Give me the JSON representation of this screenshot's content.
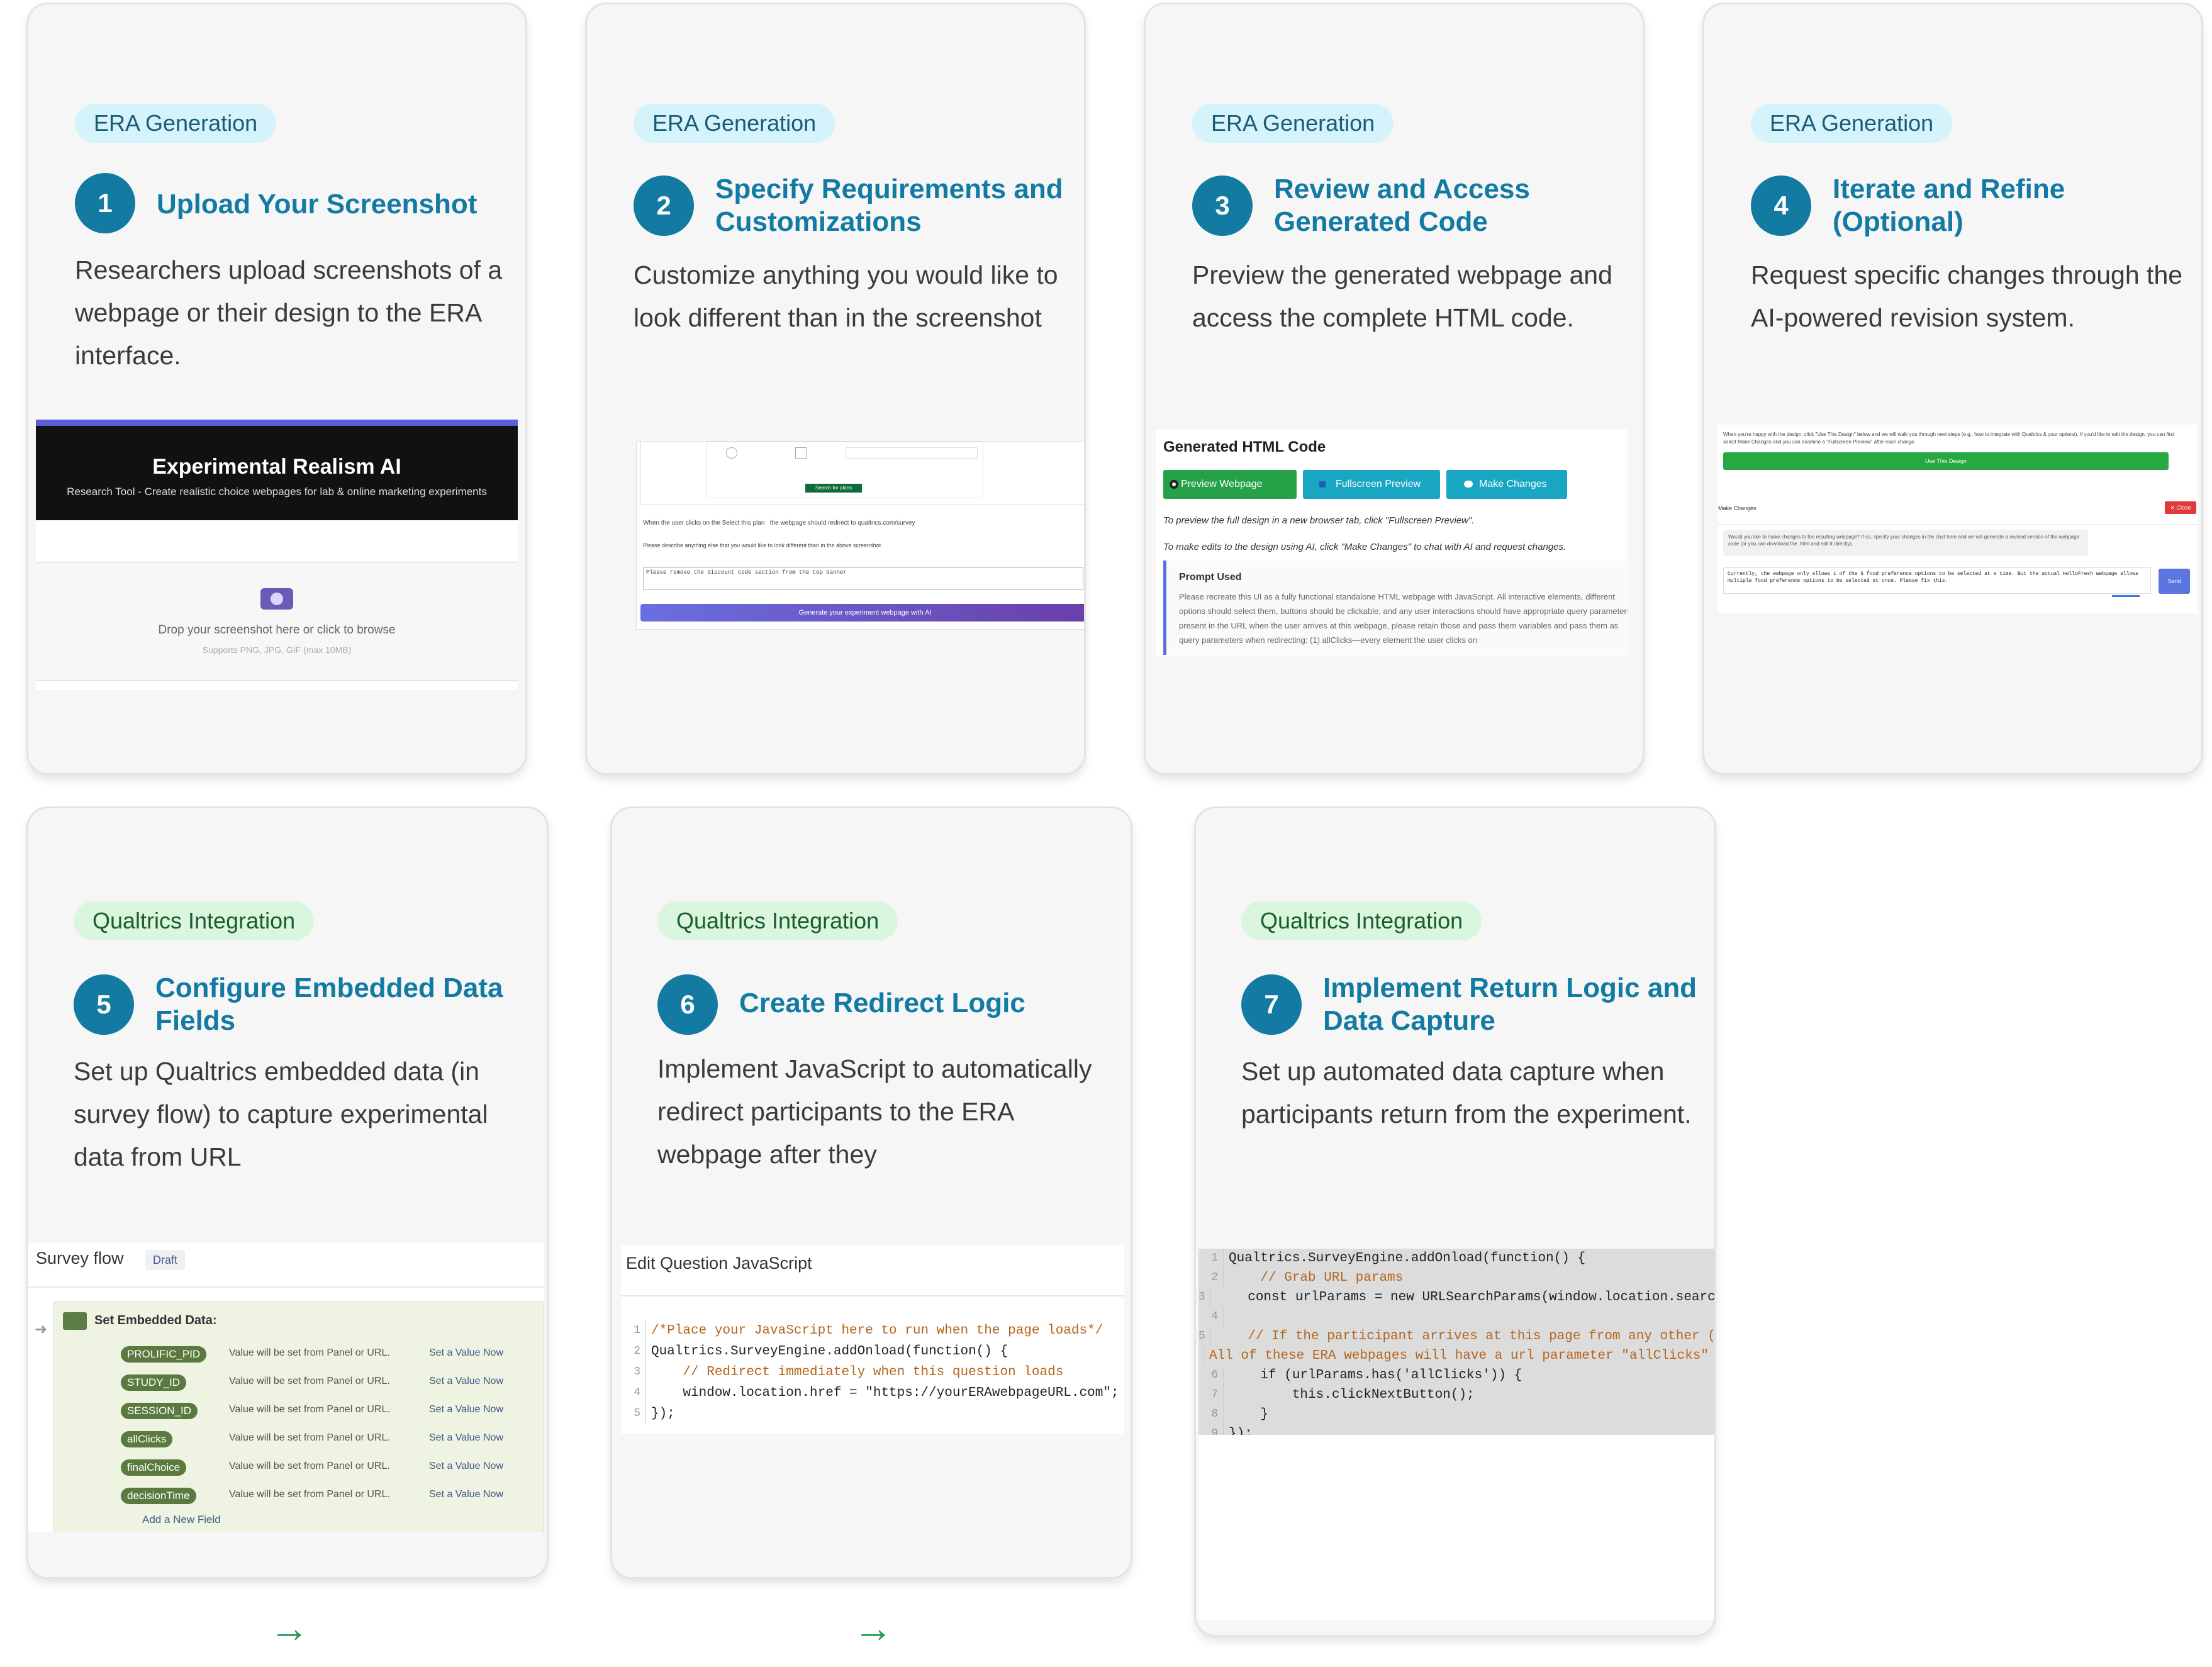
{
  "cards": [
    {
      "tag": "ERA Generation",
      "num": "1",
      "title": "Upload Your Screenshot",
      "desc": "Researchers upload screenshots of a webpage or their design to the ERA interface."
    },
    {
      "tag": "ERA Generation",
      "num": "2",
      "title": "Specify Requirements and Customizations",
      "desc": "Customize anything you would like to look different than in the screenshot"
    },
    {
      "tag": "ERA Generation",
      "num": "3",
      "title": "Review and Access Generated Code",
      "desc": "Preview the generated webpage and access the complete HTML code."
    },
    {
      "tag": "ERA Generation",
      "num": "4",
      "title": "Iterate and Refine (Optional)",
      "desc": "Request specific changes through the AI-powered revision system."
    },
    {
      "tag": "Qualtrics Integration",
      "num": "5",
      "title": "Configure Embedded Data Fields",
      "desc": "Set up Qualtrics embedded data (in survey flow) to capture experimental data from URL"
    },
    {
      "tag": "Qualtrics Integration",
      "num": "6",
      "title": "Create Redirect Logic",
      "desc": "Implement JavaScript to automatically redirect participants to the ERA webpage after they"
    },
    {
      "tag": "Qualtrics Integration",
      "num": "7",
      "title": "Implement Return Logic and Data Capture",
      "desc": "Set up automated data capture when participants return from the experiment."
    }
  ],
  "shot1": {
    "title": "Experimental Realism AI",
    "subtitle": "Research Tool - Create realistic choice webpages for lab & online marketing experiments",
    "drop": "Drop your screenshot here or click to browse",
    "supports": "Supports PNG, JPG, GIF (max 10MB)",
    "icon": "camera-icon"
  },
  "shot2": {
    "line1": "When the user clicks on the Select this plan",
    "line2": "the webpage should redirect to qualtrics.com/survey",
    "prompt": "Please describe anything else that you would like to look different than in the above screenshot",
    "textarea": "Please remove the discount code section from the top banner",
    "button": "Generate your experiment webpage with AI",
    "mini_button": "Search for plans"
  },
  "shot3": {
    "heading": "Generated HTML Code",
    "btn_preview": "Preview Webpage",
    "btn_fullscreen": "Fullscreen Preview",
    "btn_changes": "Make Changes",
    "note1": "To preview the full design in a new browser tab, click \"Fullscreen Preview\".",
    "note2": "To make edits to the design using AI, click \"Make Changes\" to chat with AI and request changes.",
    "prompt_heading": "Prompt Used",
    "prompt_text": "Please recreate this UI as a fully functional standalone HTML webpage with JavaScript. All interactive elements, different options should select them, buttons should be clickable, and any user interactions should have appropriate query parameters present in the URL when the user arrives at this webpage, please retain those and pass them variables and pass them as query parameters when redirecting: (1) allClicks—every element the user clicks on"
  },
  "shot4": {
    "intro": "When you're happy with the design, click \"Use This Design\" below and we will walk you through next steps (e.g., how to integrate with Qualtrics & your options). If you'd like to edit the design, you can first select Make Changes and you can examine a \"Fullscreen Preview\" after each change.",
    "use_button": "Use This Design",
    "make_changes": "Make Changes",
    "close": "✕ Close",
    "bot_msg": "Would you like to make changes to the resulting webpage? If so, specify your changes in the chat here and we will generate a revised version of the webpage code (or you can download the .html and edit it directly).",
    "user_msg": "Currently, the webpage only allows 1 of the 6 food preference options to be selected at a time. But the actual HelloFresh webpage allows multiple food preference options to be selected at once. Please fix this.",
    "send": "Send"
  },
  "shot5": {
    "title": "Survey flow",
    "badge": "Draft",
    "block": "Set Embedded Data:",
    "fields": [
      {
        "name": "PROLIFIC_PID",
        "note": "Value will be set from Panel or URL.",
        "action": "Set a Value Now"
      },
      {
        "name": "STUDY_ID",
        "note": "Value will be set from Panel or URL.",
        "action": "Set a Value Now"
      },
      {
        "name": "SESSION_ID",
        "note": "Value will be set from Panel or URL.",
        "action": "Set a Value Now"
      },
      {
        "name": "allClicks",
        "note": "Value will be set from Panel or URL.",
        "action": "Set a Value Now"
      },
      {
        "name": "finalChoice",
        "note": "Value will be set from Panel or URL.",
        "action": "Set a Value Now"
      },
      {
        "name": "decisionTime",
        "note": "Value will be set from Panel or URL.",
        "action": "Set a Value Now"
      }
    ],
    "add": "Add a New Field"
  },
  "shot6": {
    "title": "Edit Question JavaScript",
    "lines": [
      {
        "n": "1",
        "t": "/*Place your JavaScript here to run when the page loads*/"
      },
      {
        "n": "2",
        "t": "Qualtrics.SurveyEngine.addOnload(function() {"
      },
      {
        "n": "3",
        "t": "    // Redirect immediately when this question loads"
      },
      {
        "n": "4",
        "t": "    window.location.href = \"https://yourERAwebpageURL.com\";"
      },
      {
        "n": "5",
        "t": "});"
      }
    ]
  },
  "shot7": {
    "lines": [
      {
        "n": "1",
        "t": "Qualtrics.SurveyEngine.addOnload(function() {"
      },
      {
        "n": "2",
        "t": "    // Grab URL params"
      },
      {
        "n": "3",
        "t": "    const urlParams = new URLSearchParams(window.location.search);"
      },
      {
        "n": "4",
        "t": ""
      },
      {
        "n": "5",
        "t": "    // If the participant arrives at this page from any other (i.e."
      },
      {
        "n": "",
        "t": "All of these ERA webpages will have a url parameter \"allClicks\" whi"
      },
      {
        "n": "6",
        "t": "    if (urlParams.has('allClicks')) {"
      },
      {
        "n": "7",
        "t": "        this.clickNextButton();"
      },
      {
        "n": "8",
        "t": "    }"
      },
      {
        "n": "9",
        "t": "});"
      }
    ]
  },
  "arrows": [
    "→",
    "→"
  ]
}
